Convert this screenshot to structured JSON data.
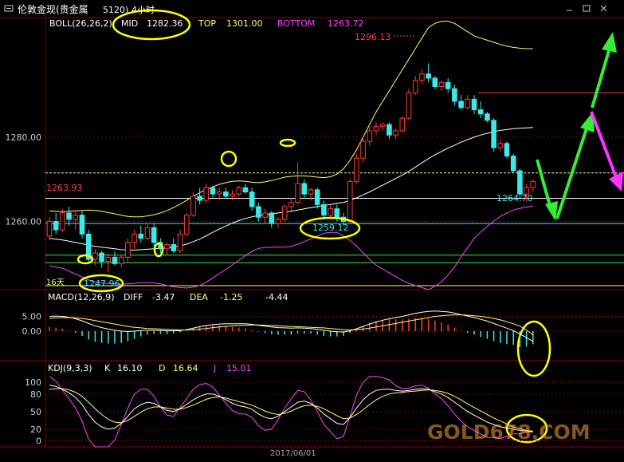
{
  "window": {
    "title": "伦敦金现(贵金属",
    "title_suffix": "5120)",
    "title_period": "4小时"
  },
  "indicators": {
    "boll_label": "BOLL(26,26,2)",
    "mid_label": "MID",
    "mid_value": "1282.36",
    "top_label": "TOP",
    "top_value": "1301.00",
    "bottom_label": "BOTTOM",
    "bottom_value": "1263.72",
    "macd_label": "MACD(12,26,9)",
    "diff_label": "DIFF",
    "diff_value": "-3.47",
    "dea_label": "DEA",
    "dea_value": "-1.25",
    "macd_value": "-4.44",
    "kdj_label": "KDJ(9,3,3)",
    "k_label": "K",
    "k_value": "16.10",
    "d_label": "D",
    "d_value": "16.64",
    "j_label": "J",
    "j_value": "15.01"
  },
  "annotations": {
    "high_price": "1296.13",
    "left_price": "1263.93",
    "low_price": "1247.96",
    "support_price": "1259.12",
    "recent_price": "1264.70",
    "days_label": "16天"
  },
  "date_label": "2017/06/01",
  "watermark": "GOLD678.COM",
  "colors": {
    "up": "#ff3b3b",
    "down": "#3ce8e8",
    "boll_mid": "#ffffff",
    "boll_top": "#ffff66",
    "boll_bottom": "#ff44ff",
    "highlight": "#ffff00",
    "arrow_green": "#33ee33",
    "arrow_magenta": "#ff33ff"
  },
  "chart_data": [
    {
      "type": "candlestick",
      "y_ticks": [
        "1280.00",
        "1260.00"
      ],
      "ylim": [
        1244,
        1308
      ],
      "candles": [
        [
          1256.5,
          1261.0,
          1255.5,
          1260.0
        ],
        [
          1260.0,
          1262.0,
          1257.0,
          1258.0
        ],
        [
          1258.0,
          1263.0,
          1257.5,
          1262.0
        ],
        [
          1262.0,
          1263.5,
          1259.0,
          1260.5
        ],
        [
          1260.5,
          1262.5,
          1258.0,
          1261.5
        ],
        [
          1261.5,
          1262.5,
          1256.0,
          1257.0
        ],
        [
          1257.0,
          1258.0,
          1250.0,
          1251.0
        ],
        [
          1251.0,
          1253.5,
          1249.5,
          1252.5
        ],
        [
          1252.5,
          1253.0,
          1249.0,
          1250.5
        ],
        [
          1250.5,
          1252.5,
          1247.96,
          1251.5
        ],
        [
          1251.5,
          1253.0,
          1249.5,
          1250.0
        ],
        [
          1250.0,
          1252.0,
          1249.0,
          1251.5
        ],
        [
          1251.5,
          1256.0,
          1250.5,
          1255.0
        ],
        [
          1255.0,
          1258.0,
          1253.5,
          1257.0
        ],
        [
          1257.0,
          1259.0,
          1255.0,
          1256.0
        ],
        [
          1256.0,
          1259.5,
          1255.5,
          1258.5
        ],
        [
          1258.5,
          1259.5,
          1254.0,
          1255.0
        ],
        [
          1255.0,
          1256.0,
          1252.5,
          1253.5
        ],
        [
          1253.5,
          1255.0,
          1252.0,
          1254.5
        ],
        [
          1254.5,
          1256.0,
          1252.5,
          1253.0
        ],
        [
          1253.0,
          1258.0,
          1252.5,
          1257.0
        ],
        [
          1257.0,
          1262.0,
          1256.5,
          1261.5
        ],
        [
          1261.5,
          1267.0,
          1261.0,
          1266.0
        ],
        [
          1266.0,
          1268.0,
          1264.0,
          1265.0
        ],
        [
          1265.0,
          1269.0,
          1264.5,
          1268.0
        ],
        [
          1268.0,
          1268.5,
          1265.5,
          1266.5
        ],
        [
          1266.5,
          1268.0,
          1265.0,
          1267.0
        ],
        [
          1267.0,
          1268.0,
          1265.5,
          1266.0
        ],
        [
          1266.0,
          1267.5,
          1265.0,
          1266.5
        ],
        [
          1266.5,
          1268.5,
          1266.0,
          1268.0
        ],
        [
          1268.0,
          1269.0,
          1266.5,
          1267.0
        ],
        [
          1267.0,
          1268.0,
          1262.5,
          1263.5
        ],
        [
          1263.5,
          1264.5,
          1260.0,
          1261.0
        ],
        [
          1261.0,
          1263.0,
          1259.5,
          1262.0
        ],
        [
          1262.0,
          1262.5,
          1258.5,
          1259.5
        ],
        [
          1259.5,
          1261.0,
          1258.5,
          1260.5
        ],
        [
          1260.5,
          1264.0,
          1260.0,
          1263.5
        ],
        [
          1263.5,
          1265.5,
          1262.5,
          1264.5
        ],
        [
          1264.5,
          1274.0,
          1264.0,
          1269.0
        ],
        [
          1269.0,
          1270.0,
          1265.5,
          1266.5
        ],
        [
          1266.5,
          1268.0,
          1265.0,
          1267.5
        ],
        [
          1267.5,
          1268.0,
          1263.0,
          1264.0
        ],
        [
          1264.0,
          1265.0,
          1260.5,
          1261.5
        ],
        [
          1261.5,
          1264.0,
          1260.5,
          1263.0
        ],
        [
          1263.0,
          1264.0,
          1260.0,
          1261.0
        ],
        [
          1261.0,
          1262.0,
          1259.12,
          1260.0
        ],
        [
          1260.0,
          1270.0,
          1259.5,
          1269.5
        ],
        [
          1269.5,
          1276.0,
          1269.0,
          1275.0
        ],
        [
          1275.0,
          1280.0,
          1274.0,
          1279.0
        ],
        [
          1279.0,
          1282.5,
          1278.0,
          1281.5
        ],
        [
          1281.5,
          1283.5,
          1280.5,
          1282.5
        ],
        [
          1282.5,
          1283.5,
          1281.5,
          1283.0
        ],
        [
          1283.0,
          1283.5,
          1279.5,
          1280.5
        ],
        [
          1280.5,
          1282.0,
          1279.5,
          1281.5
        ],
        [
          1281.5,
          1285.0,
          1281.0,
          1284.5
        ],
        [
          1284.5,
          1291.5,
          1284.0,
          1290.5
        ],
        [
          1290.5,
          1294.5,
          1290.0,
          1293.5
        ],
        [
          1293.5,
          1296.13,
          1292.5,
          1295.0
        ],
        [
          1295.0,
          1297.5,
          1293.0,
          1294.0
        ],
        [
          1294.0,
          1294.5,
          1291.5,
          1292.0
        ],
        [
          1292.0,
          1293.5,
          1291.0,
          1293.0
        ],
        [
          1293.0,
          1294.0,
          1290.5,
          1291.5
        ],
        [
          1291.5,
          1292.5,
          1287.5,
          1288.5
        ],
        [
          1288.5,
          1290.0,
          1286.5,
          1287.0
        ],
        [
          1287.0,
          1290.0,
          1286.5,
          1289.0
        ],
        [
          1289.0,
          1290.0,
          1285.5,
          1286.5
        ],
        [
          1286.5,
          1288.5,
          1284.5,
          1285.5
        ],
        [
          1285.5,
          1286.0,
          1283.5,
          1284.0
        ],
        [
          1284.0,
          1284.5,
          1276.5,
          1277.5
        ],
        [
          1277.5,
          1279.5,
          1276.5,
          1278.5
        ],
        [
          1278.5,
          1279.0,
          1275.0,
          1275.5
        ],
        [
          1275.5,
          1276.0,
          1271.5,
          1272.0
        ],
        [
          1272.0,
          1272.5,
          1265.5,
          1266.5
        ],
        [
          1266.5,
          1269.0,
          1264.7,
          1268.0
        ],
        [
          1268.0,
          1270.0,
          1267.0,
          1269.5
        ]
      ],
      "boll_mid": [
        1256.0,
        1255.8,
        1255.6,
        1255.3,
        1255.0,
        1254.7,
        1254.4,
        1254.1,
        1253.9,
        1253.7,
        1253.5,
        1253.3,
        1253.2,
        1253.2,
        1253.3,
        1253.4,
        1253.5,
        1253.6,
        1253.7,
        1253.9,
        1254.2,
        1254.6,
        1255.2,
        1255.8,
        1256.6,
        1257.4,
        1258.2,
        1258.9,
        1259.6,
        1260.2,
        1260.7,
        1261.1,
        1261.4,
        1261.6,
        1261.8,
        1262.0,
        1262.2,
        1262.4,
        1262.7,
        1263.0,
        1263.3,
        1263.5,
        1263.8,
        1264.0,
        1264.3,
        1264.5,
        1265.0,
        1265.6,
        1266.3,
        1267.0,
        1267.8,
        1268.6,
        1269.4,
        1270.2,
        1271.0,
        1271.9,
        1272.9,
        1273.9,
        1274.9,
        1275.8,
        1276.6,
        1277.4,
        1278.1,
        1278.8,
        1279.4,
        1280.0,
        1280.5,
        1280.9,
        1281.3,
        1281.6,
        1281.8,
        1282.0,
        1282.1,
        1282.2,
        1282.3
      ],
      "boll_top": [
        1262.5,
        1262.4,
        1262.3,
        1262.4,
        1262.5,
        1262.6,
        1262.7,
        1262.6,
        1262.4,
        1262.1,
        1261.8,
        1261.5,
        1261.2,
        1261.1,
        1261.1,
        1261.3,
        1261.6,
        1262.0,
        1262.6,
        1263.3,
        1264.1,
        1265.0,
        1266.0,
        1266.8,
        1267.6,
        1268.2,
        1268.8,
        1269.2,
        1269.5,
        1269.6,
        1269.5,
        1269.3,
        1269.2,
        1269.4,
        1269.7,
        1270.1,
        1270.5,
        1270.7,
        1270.8,
        1270.8,
        1270.7,
        1270.5,
        1270.4,
        1270.6,
        1271.2,
        1272.5,
        1274.5,
        1277.0,
        1280.0,
        1283.0,
        1286.0,
        1288.5,
        1291.0,
        1293.5,
        1296.0,
        1298.5,
        1301.0,
        1303.5,
        1306.0,
        1307.0,
        1307.5,
        1307.5,
        1307.0,
        1306.0,
        1305.0,
        1304.0,
        1303.5,
        1303.0,
        1302.5,
        1302.0,
        1301.6,
        1301.3,
        1301.1,
        1301.0,
        1301.0
      ],
      "boll_bottom": [
        1249.5,
        1249.2,
        1248.9,
        1248.2,
        1247.5,
        1246.8,
        1246.1,
        1245.6,
        1245.4,
        1245.3,
        1245.2,
        1245.1,
        1245.2,
        1245.3,
        1245.5,
        1245.5,
        1245.4,
        1245.2,
        1244.8,
        1244.5,
        1244.3,
        1244.2,
        1244.4,
        1244.8,
        1245.6,
        1246.6,
        1247.6,
        1248.6,
        1249.7,
        1250.8,
        1251.9,
        1252.9,
        1253.6,
        1253.8,
        1253.9,
        1253.9,
        1253.9,
        1254.1,
        1254.6,
        1255.2,
        1255.9,
        1256.5,
        1257.2,
        1257.4,
        1257.4,
        1256.5,
        1255.5,
        1254.2,
        1252.6,
        1251.0,
        1249.6,
        1248.7,
        1247.8,
        1246.9,
        1246.0,
        1245.3,
        1244.8,
        1244.3,
        1243.8,
        1244.6,
        1245.7,
        1247.3,
        1249.2,
        1251.6,
        1253.8,
        1256.0,
        1257.5,
        1258.8,
        1260.1,
        1261.2,
        1262.0,
        1262.7,
        1263.1,
        1263.4,
        1263.72
      ],
      "h_lines": [
        1271.5,
        1265.5,
        1259.5,
        1252.0,
        1250.2
      ]
    },
    {
      "type": "bar",
      "name": "MACD",
      "y_ticks": [
        "5.00",
        "0.00"
      ],
      "ylim": [
        -10,
        10
      ],
      "diff": [
        5.0,
        5.1,
        5.0,
        4.7,
        4.2,
        3.5,
        2.6,
        1.8,
        1.2,
        0.7,
        0.3,
        0.0,
        -0.1,
        0.0,
        0.2,
        0.3,
        0.3,
        0.2,
        0.1,
        0.1,
        0.2,
        0.5,
        1.0,
        1.5,
        1.9,
        2.2,
        2.4,
        2.5,
        2.5,
        2.5,
        2.5,
        2.3,
        2.0,
        1.7,
        1.4,
        1.2,
        1.1,
        1.0,
        1.1,
        1.0,
        0.9,
        0.6,
        0.3,
        0.0,
        -0.2,
        -0.3,
        0.1,
        0.8,
        1.6,
        2.4,
        3.1,
        3.7,
        4.2,
        4.6,
        5.0,
        5.5,
        6.0,
        6.4,
        6.7,
        6.8,
        6.7,
        6.5,
        6.1,
        5.6,
        5.1,
        4.6,
        4.0,
        3.4,
        2.6,
        1.8,
        1.0,
        0.2,
        -1.0,
        -2.2,
        -3.47
      ],
      "dea": [
        4.3,
        4.5,
        4.6,
        4.6,
        4.5,
        4.3,
        4.0,
        3.6,
        3.2,
        2.8,
        2.4,
        2.0,
        1.6,
        1.3,
        1.1,
        0.9,
        0.8,
        0.7,
        0.6,
        0.5,
        0.4,
        0.4,
        0.5,
        0.7,
        0.9,
        1.2,
        1.4,
        1.6,
        1.8,
        1.9,
        2.0,
        2.1,
        2.1,
        2.0,
        1.9,
        1.8,
        1.7,
        1.6,
        1.5,
        1.4,
        1.3,
        1.2,
        1.1,
        0.9,
        0.7,
        0.5,
        0.4,
        0.5,
        0.7,
        1.0,
        1.4,
        1.8,
        2.2,
        2.6,
        3.0,
        3.4,
        3.8,
        4.2,
        4.6,
        5.0,
        5.2,
        5.4,
        5.5,
        5.5,
        5.4,
        5.2,
        5.0,
        4.7,
        4.3,
        3.8,
        3.2,
        2.5,
        1.7,
        0.4,
        -1.25
      ],
      "macd": [
        1.4,
        1.2,
        0.8,
        0.2,
        -0.6,
        -1.6,
        -2.8,
        -3.6,
        -4.0,
        -4.2,
        -4.2,
        -4.0,
        -3.4,
        -2.6,
        -1.8,
        -1.2,
        -1.0,
        -1.0,
        -1.0,
        -0.8,
        -0.4,
        0.2,
        1.0,
        1.6,
        2.0,
        2.0,
        2.0,
        1.8,
        1.4,
        1.2,
        1.0,
        0.4,
        -0.2,
        -0.6,
        -1.0,
        -1.2,
        -1.2,
        -1.2,
        -0.8,
        -0.8,
        -0.8,
        -1.2,
        -1.6,
        -1.8,
        -1.8,
        -1.6,
        -0.6,
        0.6,
        1.8,
        2.8,
        3.4,
        3.8,
        4.0,
        4.0,
        4.0,
        4.2,
        4.4,
        4.4,
        4.2,
        3.6,
        3.0,
        2.2,
        1.2,
        0.2,
        -0.6,
        -1.2,
        -2.0,
        -2.6,
        -3.4,
        -4.0,
        -4.4,
        -4.6,
        -5.4,
        -5.2,
        -4.44
      ]
    },
    {
      "type": "line",
      "name": "KDJ",
      "y_ticks": [
        "100",
        "80",
        "50",
        "20",
        "0"
      ],
      "ylim": [
        -10,
        115
      ],
      "k": [
        95,
        93,
        88,
        82,
        74,
        62,
        45,
        32,
        24,
        20,
        22,
        30,
        42,
        55,
        62,
        66,
        64,
        58,
        52,
        50,
        55,
        62,
        70,
        76,
        80,
        80,
        76,
        70,
        64,
        60,
        58,
        54,
        46,
        40,
        38,
        42,
        50,
        58,
        66,
        68,
        64,
        56,
        46,
        38,
        30,
        28,
        40,
        56,
        70,
        80,
        86,
        88,
        88,
        86,
        85,
        86,
        88,
        89,
        88,
        84,
        80,
        74,
        66,
        58,
        50,
        44,
        38,
        32,
        28,
        24,
        22,
        20,
        18,
        17,
        16.1
      ],
      "d": [
        88,
        89,
        89,
        87,
        83,
        76,
        66,
        55,
        45,
        37,
        32,
        31,
        35,
        42,
        49,
        55,
        58,
        58,
        56,
        54,
        54,
        57,
        61,
        66,
        71,
        74,
        75,
        73,
        70,
        67,
        64,
        61,
        56,
        51,
        47,
        45,
        47,
        51,
        56,
        60,
        61,
        59,
        55,
        49,
        43,
        38,
        39,
        45,
        53,
        62,
        70,
        76,
        80,
        82,
        83,
        84,
        85,
        86,
        87,
        86,
        84,
        81,
        76,
        70,
        63,
        57,
        51,
        45,
        39,
        34,
        29,
        24,
        21,
        18,
        16.64
      ],
      "j": [
        110,
        102,
        86,
        72,
        56,
        34,
        3,
        -10,
        -10,
        -10,
        2,
        28,
        56,
        80,
        88,
        88,
        76,
        58,
        44,
        42,
        57,
        72,
        88,
        96,
        98,
        92,
        78,
        64,
        52,
        46,
        46,
        40,
        26,
        18,
        20,
        36,
        56,
        72,
        86,
        84,
        70,
        50,
        28,
        16,
        4,
        8,
        42,
        78,
        100,
        110,
        110,
        108,
        104,
        94,
        89,
        90,
        94,
        95,
        90,
        80,
        72,
        60,
        46,
        34,
        24,
        18,
        12,
        6,
        6,
        4,
        8,
        12,
        12,
        15,
        15.01
      ]
    }
  ]
}
